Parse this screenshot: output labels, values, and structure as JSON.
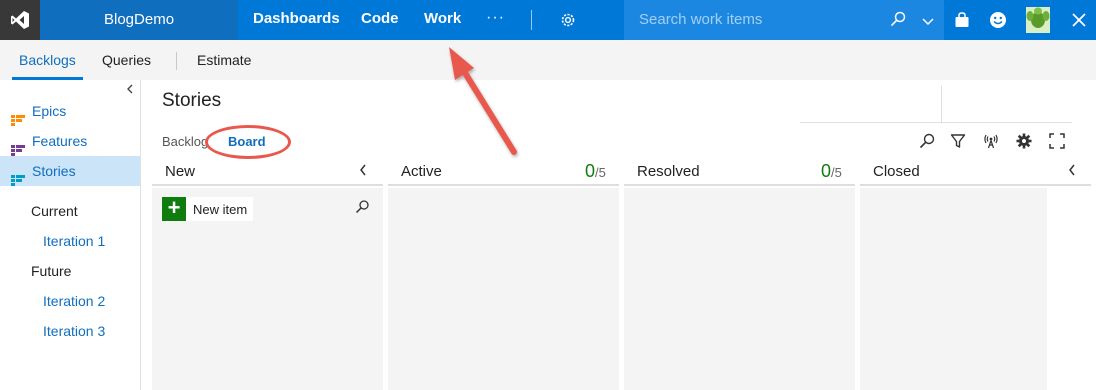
{
  "topbar": {
    "project": "BlogDemo",
    "nav": [
      "Dashboards",
      "Code",
      "Work"
    ],
    "more": "···",
    "search_placeholder": "Search work items"
  },
  "hub": {
    "tabs": [
      "Backlogs",
      "Queries",
      "Estimate"
    ],
    "active_tab": "Backlogs"
  },
  "leftnav": {
    "items": [
      {
        "label": "Epics",
        "color": "#ff8c00"
      },
      {
        "label": "Features",
        "color": "#773b93"
      },
      {
        "label": "Stories",
        "color": "#009ccc"
      }
    ],
    "selected": "Stories",
    "groups": [
      {
        "label": "Current",
        "iterations": [
          "Iteration 1"
        ]
      },
      {
        "label": "Future",
        "iterations": [
          "Iteration 2",
          "Iteration 3"
        ]
      }
    ]
  },
  "main": {
    "title": "Stories",
    "pivots": [
      "Backlog",
      "Board"
    ],
    "active_pivot": "Board"
  },
  "board": {
    "columns": [
      {
        "name": "New",
        "count": "",
        "limit": ""
      },
      {
        "name": "Active",
        "count": "0",
        "limit": "/5"
      },
      {
        "name": "Resolved",
        "count": "0",
        "limit": "/5"
      },
      {
        "name": "Closed",
        "count": "",
        "limit": ""
      }
    ],
    "new_item_label": "New item"
  },
  "colors": {
    "accent": "#0078d7",
    "annotation": "#e8584d",
    "wip_count": "#107c10"
  }
}
